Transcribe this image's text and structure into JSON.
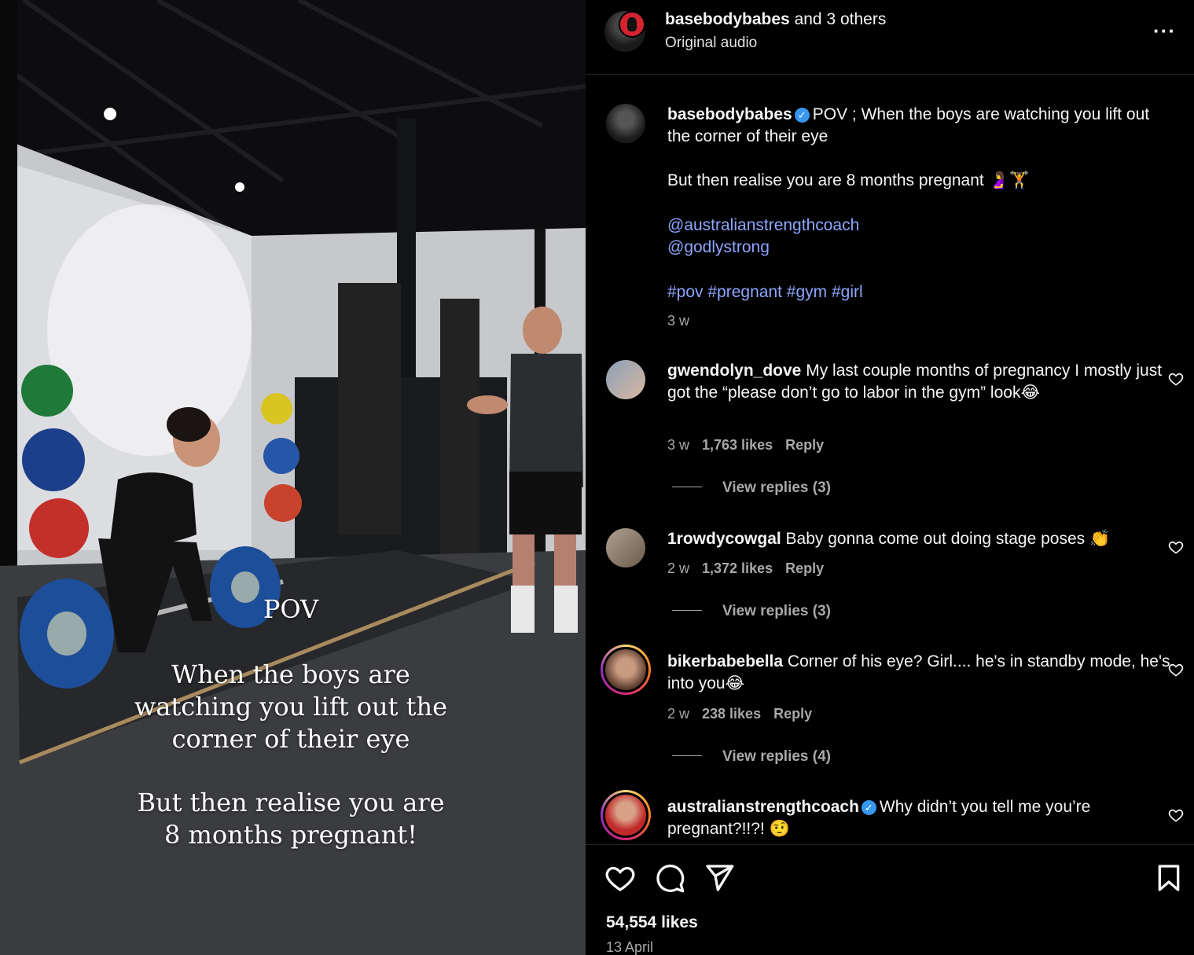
{
  "overlay": {
    "pov": "POV",
    "line1": "When the boys are watching you lift out the corner of their eye",
    "line2": "But then realise you are 8 months pregnant!"
  },
  "header": {
    "author": "basebodybabes",
    "and_others": "and 3 others",
    "audio": "Original audio",
    "more_icon": "more-horizontal-icon"
  },
  "caption": {
    "user": "basebodybabes",
    "text1": "POV ; When the boys are watching you lift out the corner of their eye",
    "text2": "But then realise you are 8 months pregnant 🤰🏋️",
    "mention1": "@australianstrengthcoach",
    "mention2": "@godlystrong",
    "hashtags": "#pov #pregnant #gym #girl",
    "time": "3 w"
  },
  "comments": [
    {
      "user": "gwendolyn_dove",
      "text": "My last couple months of pregnancy I mostly just got the “please don’t go to labor in the gym” look😂",
      "time": "3 w",
      "likes": "1,763 likes",
      "reply": "Reply",
      "view_replies": "View replies (3)"
    },
    {
      "user": "1rowdycowgal",
      "text": "Baby gonna come out doing stage poses 👏",
      "time": "2 w",
      "likes": "1,372 likes",
      "reply": "Reply",
      "view_replies": "View replies (3)"
    },
    {
      "user": "bikerbabebella",
      "text": "Corner of his eye? Girl.... he's in standby mode, he's into you😂",
      "time": "2 w",
      "likes": "238 likes",
      "reply": "Reply",
      "view_replies": "View replies (4)"
    },
    {
      "user": "australianstrengthcoach",
      "text": "Why didn’t you tell me you’re pregnant?!!?! 🤨",
      "verified": true
    }
  ],
  "footer": {
    "likes": "54,554 likes",
    "date": "13 April"
  },
  "colors": {
    "background": "#000000",
    "text": "#f5f5f5",
    "muted": "#a8a8a8",
    "link": "#8da6ff",
    "verified": "#3897f0"
  }
}
